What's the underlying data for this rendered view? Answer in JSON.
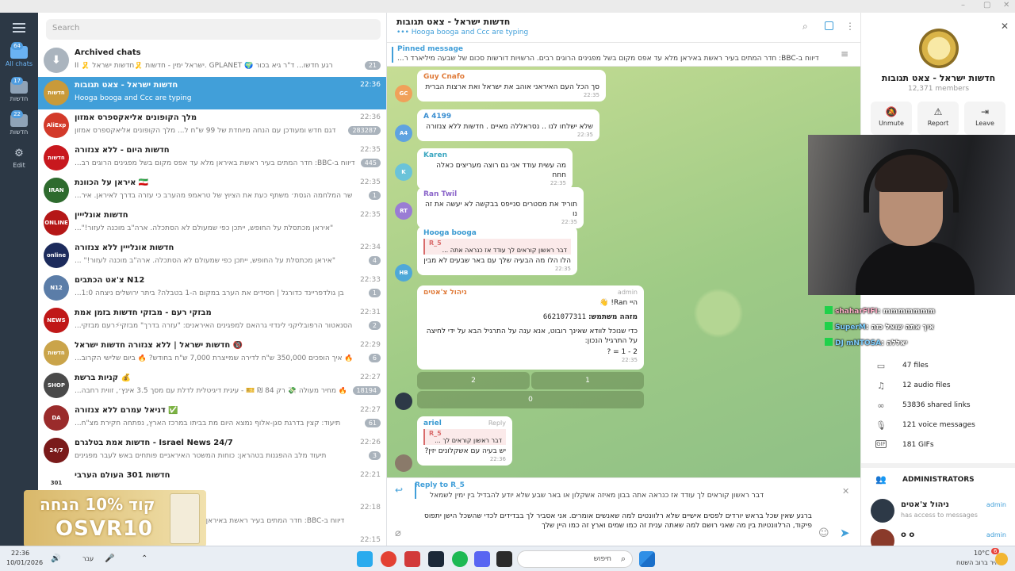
{
  "window": {
    "ctl_min": "–",
    "ctl_max": "▢",
    "ctl_close": "✕"
  },
  "rail": {
    "folders": [
      {
        "label": "All chats",
        "badge": "64",
        "icon": "chat-bubbles-icon"
      },
      {
        "label": "חדשות",
        "badge": "17",
        "icon": "folder-icon"
      },
      {
        "label": "חדשות",
        "badge": "22",
        "icon": "folder-icon"
      },
      {
        "label": "Edit",
        "badge": "",
        "icon": "sliders-icon"
      }
    ]
  },
  "list": {
    "search_placeholder": "Search",
    "archived": {
      "title": "Archived chats",
      "preview": "רגע חדשו... ד\"ר גיא בכור 🌍 GPLANET .ישראל ימין - חדשות 🎗️חדשות ישראל 🎗️ II",
      "count": "21"
    },
    "chats": [
      {
        "name": "חדשות ישראל - צאט תגובות",
        "time": "22:36",
        "preview": "Hooga booga and Ccc are typing",
        "count": "",
        "color": "#c99a3a",
        "av": "חדשות"
      },
      {
        "name": "מלך הקופונים אליאקספרס אמזון",
        "time": "22:36",
        "preview": "דגם חדש ומעודכן עם הנחה מיוחדת של 99 ש\"ח ל... מלך הקופונים אליאקספרס אמזון",
        "count": "283287",
        "color": "#d33a2a",
        "av": "AliExp"
      },
      {
        "name": "חדשות היום - ללא צנזורה",
        "time": "22:35",
        "preview": "דיווח ב-BBC: חדר המתים בעיר ראשת באיראן מלא עד אפס מקום בשל מפגינים הרוגים רב...",
        "count": "445",
        "color": "#c8181e",
        "av": "חדשות היום"
      },
      {
        "name": "איראן על הכוונת 🇮🇷",
        "time": "22:35",
        "preview": "שר המלחמה הגסת׳ משתף כעת את הציוץ של טראמפ מהערב כי עזרה בדרך לאיראן. איר...",
        "count": "1",
        "color": "#2e6b2e",
        "av": "IRAN"
      },
      {
        "name": "חדשות אונלייין",
        "time": "22:35",
        "preview": "\"איראן מכתסלת על החופש, ייתכן כפי שמעולם לא הסתכלה. ארה\"ב מוכנה לעזור!\"...",
        "count": "",
        "color": "#b51717",
        "av": "ONLINE"
      },
      {
        "name": "חדשות אונלייין ללא צנזורה",
        "time": "22:34",
        "preview": "\"איראן מכתסלת על החופש, ייתכן כפי שמעולם לא הסתכלה. ארה\"ב מוכנה לעזור!\" ...",
        "count": "4",
        "color": "#1c2b5c",
        "av": "online"
      },
      {
        "name": "צ'אט הכתבים N12",
        "time": "22:33",
        "preview": "בן גולדפריינד כדורגל | חסידים את הערב במקום ה-1 בטבלה? ביתר ירושלים ניצחה 1:0...",
        "count": "1",
        "color": "#5b7da8",
        "av": "N12"
      },
      {
        "name": "מבזקי רעם - מבזקי חדשות בזמן אמת",
        "time": "22:31",
        "preview": "הסנאטור הרפובליקני לינדזי גרהאם למפגינים האיראנים: \"עזרה בדרך\" מבזקי⚡רעם מבזקי...",
        "count": "2",
        "color": "#c01818",
        "av": "NEWS"
      },
      {
        "name": "חדשות ישראל | ללא צנזורה חדשות ישראל 🔞",
        "time": "22:29",
        "preview": "🔥 איך הופכים 350,000 ש\"ח לדירה שמייצרת 7,000 ש\"ח בחודש? 🔥 ביום שלישי הקרוב...",
        "count": "6",
        "color": "#caa44a",
        "av": "חדשות"
      },
      {
        "name": "קניות ברשת 💰",
        "time": "22:27",
        "preview": "🔥 מחיר מעולה 💸 רק 84 ₪ 🎫 - עיגית דיגיטלית לדלת עם מסך 3.5 אינץ׳, זווית רחבה...",
        "count": "18194",
        "color": "#4a4a4a",
        "av": "SHOP"
      },
      {
        "name": "דניאל עמרם ללא צנזורה ✅",
        "time": "22:27",
        "preview": "תיעוד: קצין בדרגת סגן-אלוף נמצא היום מת בביתו במרכז הארץ, נפתחה חקירת מצ\"ח...",
        "count": "61",
        "color": "#9a2b2b",
        "av": "DA"
      },
      {
        "name": "חדשות אמת בטלגרם - Israel News 24/7",
        "time": "22:26",
        "preview": "תיעוד מלב ההפגנות בטהראן: כוחות המשטר האיראניים פותחים באש לעבר מפגינים",
        "count": "3",
        "color": "#7a1a1a",
        "av": "24/7"
      },
      {
        "name": "חדשות 301 העולם הערבי",
        "time": "22:21",
        "preview": "",
        "count": "",
        "color": "#ffffff",
        "av": "301"
      },
      {
        "name": "",
        "time": "22:18",
        "preview": "דיווח ב-BBC: חדר המתים בעיר ראשת באיראן מלא עד אפס מקום בשל מפגינים הרוגים...",
        "count": "",
        "color": "#ffffff",
        "av": ""
      },
      {
        "name": "",
        "time": "22:15",
        "preview": "",
        "count": "",
        "color": "#ffffff",
        "av": ""
      }
    ]
  },
  "promo": {
    "line1": "קוד 10% הנחה",
    "line2": "OSVR10"
  },
  "conv": {
    "title": "חדשות ישראל - צאט תגובות",
    "status": "••• Hooga booga and Ccc are typing",
    "pinned_label": "Pinned message",
    "pinned_text": "דיווח ב-BBC: חדר המתים בעיר ראשת באיראן מלא עד אפס מקום בשל מפגינים הרוגים רבים. הרשויות דורשות סכום של שבעה מיליארד ר...",
    "messages": [
      {
        "initials": "GC",
        "color": "#f0a15a",
        "author": "Guy Cnafo",
        "author_color": "#e07b3a",
        "text": "סך הכל העם האיראני אוהב את ישראל ואת ארצות הברית",
        "time": "22:35"
      },
      {
        "initials": "A4",
        "color": "#5fa3e0",
        "author": "A 4199",
        "author_color": "#3a8ed1",
        "text": "שלא ישלחו לנו .. נסראללה מאיים . חדשות ללא צנזורה",
        "time": "22:35"
      },
      {
        "initials": "K",
        "color": "#6ac3d9",
        "author": "Karen",
        "author_color": "#3aa6c0",
        "text": "מה עשית עודד אני גם רוצה מעריצים כאלה חחח",
        "time": "22:35"
      },
      {
        "initials": "RT",
        "color": "#9a7cd4",
        "author": "Ran Twil",
        "author_color": "#8a64c9",
        "text": "תוריד את מסטרים סנייפס בבקשה לא יעשה את זה נו",
        "time": "22:35"
      },
      {
        "initials": "HB",
        "color": "#4fa8d8",
        "author": "Hooga booga",
        "author_color": "#3a9ad1",
        "quote_name": "R_5",
        "quote": "דבר ראשון קוראים לך עודד אז כנראה אתה ...",
        "text": "הלו הלו מה הבעיה שלך עם באר שבעים לא מבין",
        "time": "22:35"
      }
    ],
    "bot": {
      "author": "ניהול צ'אטים",
      "role": "admin",
      "line1": "היי Ran! 👋",
      "line2_label": "מזהה משתמש:",
      "line2_val": "6621077311",
      "line3": "כדי שנוכל לוודא שאינך רובוט, אנא ענה על התרגיל הבא על ידי לחיצה על התרגיל הנכון:",
      "line4": "2 - 1 = ?",
      "time": "22:35",
      "buttons": [
        "2",
        "1",
        "0"
      ]
    },
    "ariel": {
      "author": "ariel",
      "reply": "Reply",
      "quote_name": "R_5",
      "quote": "דבר ראשון קוראים לך ...",
      "text": "יש בעיה עם אשקלונים יזין?",
      "time": "22:36"
    },
    "composer": {
      "reply_label": "Reply to R_5",
      "reply_text": "דבר ראשון קוראים לך עודד אז כנראה אתה בבון מאיזה אשקלון או באר שבע שלא יודע להבדיל בין ימין לשמאל",
      "text": "ברגע שאין שכל בראש יורדים לפסים אישיים שלא רלוונטים למה שאנשים אומרים. אני אסביר לך בבדידים לכדי שהשכל הישן יתפוס פיקוד, הרלוונטיות בין מה שאני רושם למה שאתה ענית זה כמו שמים וארץ זה כמו היין שלך"
    }
  },
  "info": {
    "title": "חדשות ישראל - צאט תגובות",
    "members": "12,371 members",
    "actions": [
      {
        "label": "Unmute",
        "icon": "bell-off-icon"
      },
      {
        "label": "Report",
        "icon": "alert-icon"
      },
      {
        "label": "Leave",
        "icon": "leave-icon"
      }
    ],
    "media": [
      {
        "label": "47 files",
        "icon": "file-icon"
      },
      {
        "label": "12 audio files",
        "icon": "headphones-icon"
      },
      {
        "label": "53836 shared links",
        "icon": "link-icon"
      },
      {
        "label": "121 voice messages",
        "icon": "mic-icon"
      },
      {
        "label": "181 GIFs",
        "icon": "gif-icon"
      }
    ],
    "admins_header": "ADMINISTRATORS",
    "admins": [
      {
        "name": "ניהול צ'אטים",
        "sub": "has access to messages",
        "role": "admin"
      },
      {
        "name": "o o",
        "sub": "",
        "role": "admin"
      }
    ]
  },
  "stream": {
    "lines": [
      {
        "user": "shaharFIFI",
        "msg": "mmmmmmm"
      },
      {
        "user": "SuperM",
        "msg": "איך אתה שואל כזה"
      },
      {
        "user": "DJ mNTOSA",
        "msg": "יאללה"
      }
    ]
  },
  "taskbar": {
    "time": "22:36",
    "date": "10/01/2026",
    "lang": "עבר",
    "search": "חיפוש",
    "weather_temp": "10°C",
    "weather_desc": "בהיר ברוב השטח",
    "weather_badge": "6"
  }
}
